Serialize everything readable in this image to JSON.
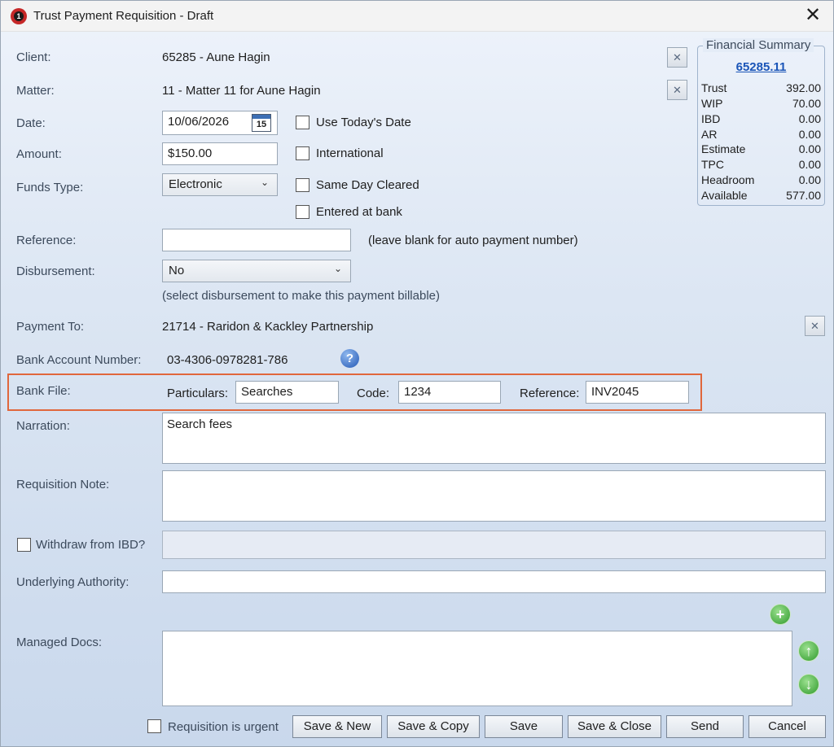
{
  "window": {
    "title": "Trust Payment Requisition - Draft",
    "logo_text": "1"
  },
  "labels": {
    "client": "Client:",
    "matter": "Matter:",
    "date": "Date:",
    "amount": "Amount:",
    "funds_type": "Funds Type:",
    "reference": "Reference:",
    "disbursement": "Disbursement:",
    "payment_to": "Payment To:",
    "bank_account_number": "Bank Account Number:",
    "bank_file": "Bank File:",
    "narration": "Narration:",
    "requisition_note": "Requisition Note:",
    "underlying_authority": "Underlying Authority:",
    "managed_docs": "Managed Docs:"
  },
  "values": {
    "client": "65285 - Aune Hagin",
    "matter": "11 - Matter 11 for Aune Hagin",
    "date": "10/06/2026",
    "calendar_day": "15",
    "amount": "$150.00",
    "funds_type": "Electronic",
    "reference": "",
    "reference_hint": "(leave blank for auto payment number)",
    "disbursement": "No",
    "disbursement_hint": "(select disbursement to make this payment billable)",
    "payment_to": "21714 - Raridon & Kackley Partnership",
    "bank_account_number": "03-4306-0978281-786",
    "narration": "Search fees",
    "requisition_note": "",
    "underlying_authority": ""
  },
  "checkboxes": {
    "use_todays_date": "Use Today's Date",
    "international": "International",
    "same_day_cleared": "Same Day Cleared",
    "entered_at_bank": "Entered at bank",
    "withdraw_from_ibd": "Withdraw from IBD?",
    "requisition_urgent": "Requisition is urgent"
  },
  "bank_file": {
    "particulars_label": "Particulars:",
    "particulars": "Searches",
    "code_label": "Code:",
    "code": "1234",
    "reference_label": "Reference:",
    "reference": "INV2045"
  },
  "financial_summary": {
    "title": "Financial Summary",
    "link": "65285.11",
    "rows": [
      {
        "key": "Trust",
        "value": "392.00"
      },
      {
        "key": "WIP",
        "value": "70.00"
      },
      {
        "key": "IBD",
        "value": "0.00"
      },
      {
        "key": "AR",
        "value": "0.00"
      },
      {
        "key": "Estimate",
        "value": "0.00"
      },
      {
        "key": "TPC",
        "value": "0.00"
      },
      {
        "key": "Headroom",
        "value": "0.00"
      },
      {
        "key": "Available",
        "value": "577.00"
      }
    ]
  },
  "buttons": {
    "save_new": "Save & New",
    "save_copy": "Save & Copy",
    "save": "Save",
    "save_close": "Save & Close",
    "send": "Send",
    "cancel": "Cancel",
    "close_glyph": "✕",
    "clear_glyph": "✕",
    "help_glyph": "?",
    "dropdown_glyph": "⌄",
    "add_glyph": "+",
    "up_glyph": "↑",
    "down_glyph": "↓"
  },
  "colors": {
    "accent_highlight": "#e0673c",
    "link": "#1a55b8"
  }
}
